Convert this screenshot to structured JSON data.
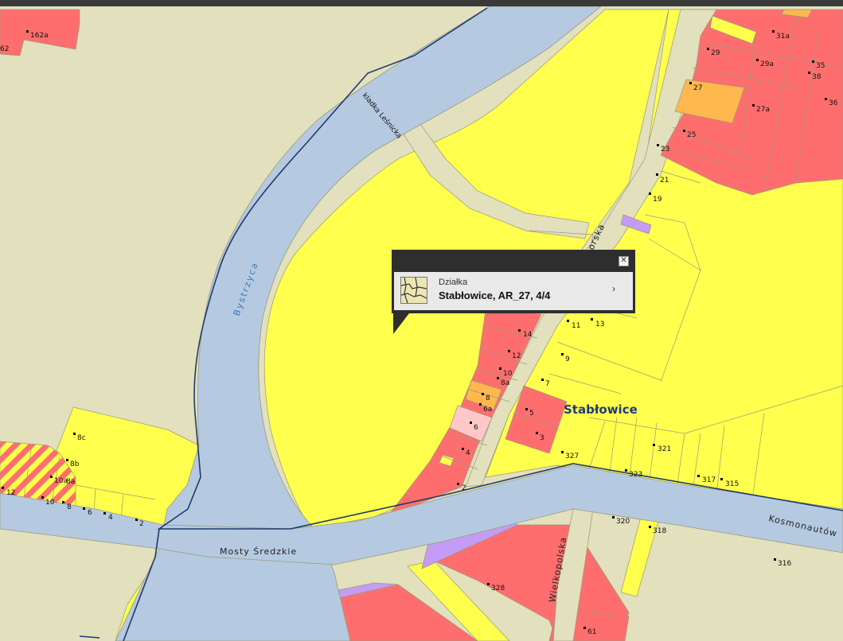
{
  "map": {
    "place_label": "Stabłowice",
    "roads": {
      "bystrzyca": "Bystrzyca",
      "kladka": "kladka Leśnicka",
      "mosty": "Mosty Średzkie",
      "kosmonautow": "Kosmonautów",
      "wielkopolska": "Wielkopolska",
      "upper_street": "orska"
    },
    "parcel_numbers": {
      "n162a": "162a",
      "n62": "62",
      "n31a": "31a",
      "n29": "29",
      "n29a": "29a",
      "n35": "35",
      "n38": "38",
      "n27": "27",
      "n27a": "27a",
      "n36": "36",
      "n25": "25",
      "n23": "23",
      "n21": "21",
      "n19": "19",
      "n14": "14",
      "n11": "11",
      "n13": "13",
      "n12": "12",
      "n9": "9",
      "n10": "10",
      "n8a": "8a",
      "n7": "7",
      "n8": "8",
      "n6a": "6a",
      "n5": "5",
      "n6": "6",
      "n3": "3",
      "n4": "4",
      "n2": "2",
      "n327": "327",
      "n321": "321",
      "n323": "323",
      "n317": "317",
      "n315": "315",
      "n8c": "8c",
      "n8b": "8b",
      "n10a": "10a",
      "n8a_w": "8a",
      "n12_w": "12",
      "n10_w": "10",
      "n8_w": "8",
      "n6_w": "6",
      "n4_w": "4",
      "n2_w": "2",
      "n320": "320",
      "n318": "318",
      "n316": "316",
      "n328": "328",
      "n61": "61"
    }
  },
  "popup": {
    "type_label": "Działka",
    "value": "Stabłowice, AR_27, 4/4",
    "close_symbol": "✕",
    "more_symbol": "›",
    "icon": "parcel-map-icon"
  },
  "colors": {
    "land": "#e2e0bd",
    "yellow": "#ffff4d",
    "red": "#ff6e6e",
    "water": "#b5cae0",
    "orange": "#ffb84d",
    "purple": "#c49cf5",
    "pink": "#ffc8c8",
    "road": "#e2e0bd",
    "popup_dark": "#2e2e2e"
  }
}
